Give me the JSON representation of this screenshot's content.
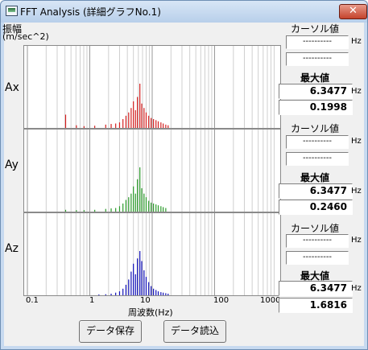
{
  "window": {
    "title": "FFT Analysis (詳細グラフNo.1)",
    "close_glyph": "✕"
  },
  "y_unit_label": "振幅",
  "y_unit": "(m/sec^2)",
  "x_axis_label": "周波数(Hz)",
  "x_ticks": [
    "0.1",
    "1",
    "10",
    "100",
    "1000"
  ],
  "channels": [
    {
      "name": "Ax",
      "cursor_label": "カーソル値",
      "cursor_freq": "----------",
      "cursor_value": "----------",
      "hz_unit": "Hz",
      "max_label": "最大値",
      "max_freq": "6.3477",
      "max_value": "0.1998",
      "color": "#d42020"
    },
    {
      "name": "Ay",
      "cursor_label": "カーソル値",
      "cursor_freq": "----------",
      "cursor_value": "----------",
      "hz_unit": "Hz",
      "max_label": "最大値",
      "max_freq": "6.3477",
      "max_value": "0.2460",
      "color": "#2a9a2a"
    },
    {
      "name": "Az",
      "cursor_label": "カーソル値",
      "cursor_freq": "----------",
      "cursor_value": "----------",
      "hz_unit": "Hz",
      "max_label": "最大値",
      "max_freq": "6.3477",
      "max_value": "1.6816",
      "color": "#1010b8"
    }
  ],
  "buttons": {
    "save": "データ保存",
    "load": "データ読込"
  },
  "spectrum": {
    "x_range_hz": [
      0.1,
      1000
    ],
    "axis_scale": "log",
    "ax": [
      [
        0.41,
        0.06
      ],
      [
        0.61,
        0.012
      ],
      [
        0.81,
        0.008
      ],
      [
        1.2,
        0.01
      ],
      [
        1.8,
        0.015
      ],
      [
        2.2,
        0.018
      ],
      [
        2.6,
        0.02
      ],
      [
        3.0,
        0.025
      ],
      [
        3.4,
        0.04
      ],
      [
        3.8,
        0.055
      ],
      [
        4.2,
        0.07
      ],
      [
        4.6,
        0.09
      ],
      [
        5.0,
        0.12
      ],
      [
        5.4,
        0.08
      ],
      [
        5.8,
        0.14
      ],
      [
        6.35,
        0.1998
      ],
      [
        6.8,
        0.11
      ],
      [
        7.4,
        0.09
      ],
      [
        8.0,
        0.07
      ],
      [
        8.8,
        0.055
      ],
      [
        9.6,
        0.045
      ],
      [
        10.5,
        0.04
      ],
      [
        11.5,
        0.035
      ],
      [
        12.5,
        0.03
      ],
      [
        13.8,
        0.025
      ],
      [
        15.0,
        0.02
      ],
      [
        16.5,
        0.015
      ],
      [
        18.0,
        0.012
      ]
    ],
    "ay": [
      [
        0.41,
        0.01
      ],
      [
        0.61,
        0.008
      ],
      [
        0.81,
        0.008
      ],
      [
        1.2,
        0.01
      ],
      [
        1.8,
        0.015
      ],
      [
        2.2,
        0.018
      ],
      [
        2.6,
        0.02
      ],
      [
        3.0,
        0.03
      ],
      [
        3.4,
        0.045
      ],
      [
        3.8,
        0.065
      ],
      [
        4.2,
        0.08
      ],
      [
        4.6,
        0.1
      ],
      [
        5.0,
        0.14
      ],
      [
        5.4,
        0.1
      ],
      [
        5.8,
        0.18
      ],
      [
        6.35,
        0.246
      ],
      [
        6.8,
        0.13
      ],
      [
        7.4,
        0.1
      ],
      [
        8.0,
        0.08
      ],
      [
        8.8,
        0.06
      ],
      [
        9.6,
        0.05
      ],
      [
        10.5,
        0.045
      ],
      [
        11.5,
        0.04
      ],
      [
        12.5,
        0.035
      ],
      [
        13.8,
        0.03
      ],
      [
        15.0,
        0.025
      ],
      [
        16.5,
        0.02
      ]
    ],
    "az": [
      [
        1.4,
        0.02
      ],
      [
        1.8,
        0.04
      ],
      [
        2.2,
        0.06
      ],
      [
        2.6,
        0.1
      ],
      [
        3.0,
        0.15
      ],
      [
        3.4,
        0.25
      ],
      [
        3.8,
        0.4
      ],
      [
        4.2,
        0.6
      ],
      [
        4.6,
        0.9
      ],
      [
        5.0,
        1.2
      ],
      [
        5.4,
        0.8
      ],
      [
        5.8,
        1.4
      ],
      [
        6.35,
        1.6816
      ],
      [
        6.8,
        1.3
      ],
      [
        7.4,
        0.95
      ],
      [
        8.0,
        0.7
      ],
      [
        8.8,
        0.5
      ],
      [
        9.6,
        0.35
      ],
      [
        10.5,
        0.25
      ],
      [
        11.5,
        0.2
      ],
      [
        12.5,
        0.15
      ],
      [
        13.8,
        0.12
      ],
      [
        15.0,
        0.1
      ],
      [
        16.5,
        0.08
      ],
      [
        18.0,
        0.06
      ]
    ]
  }
}
